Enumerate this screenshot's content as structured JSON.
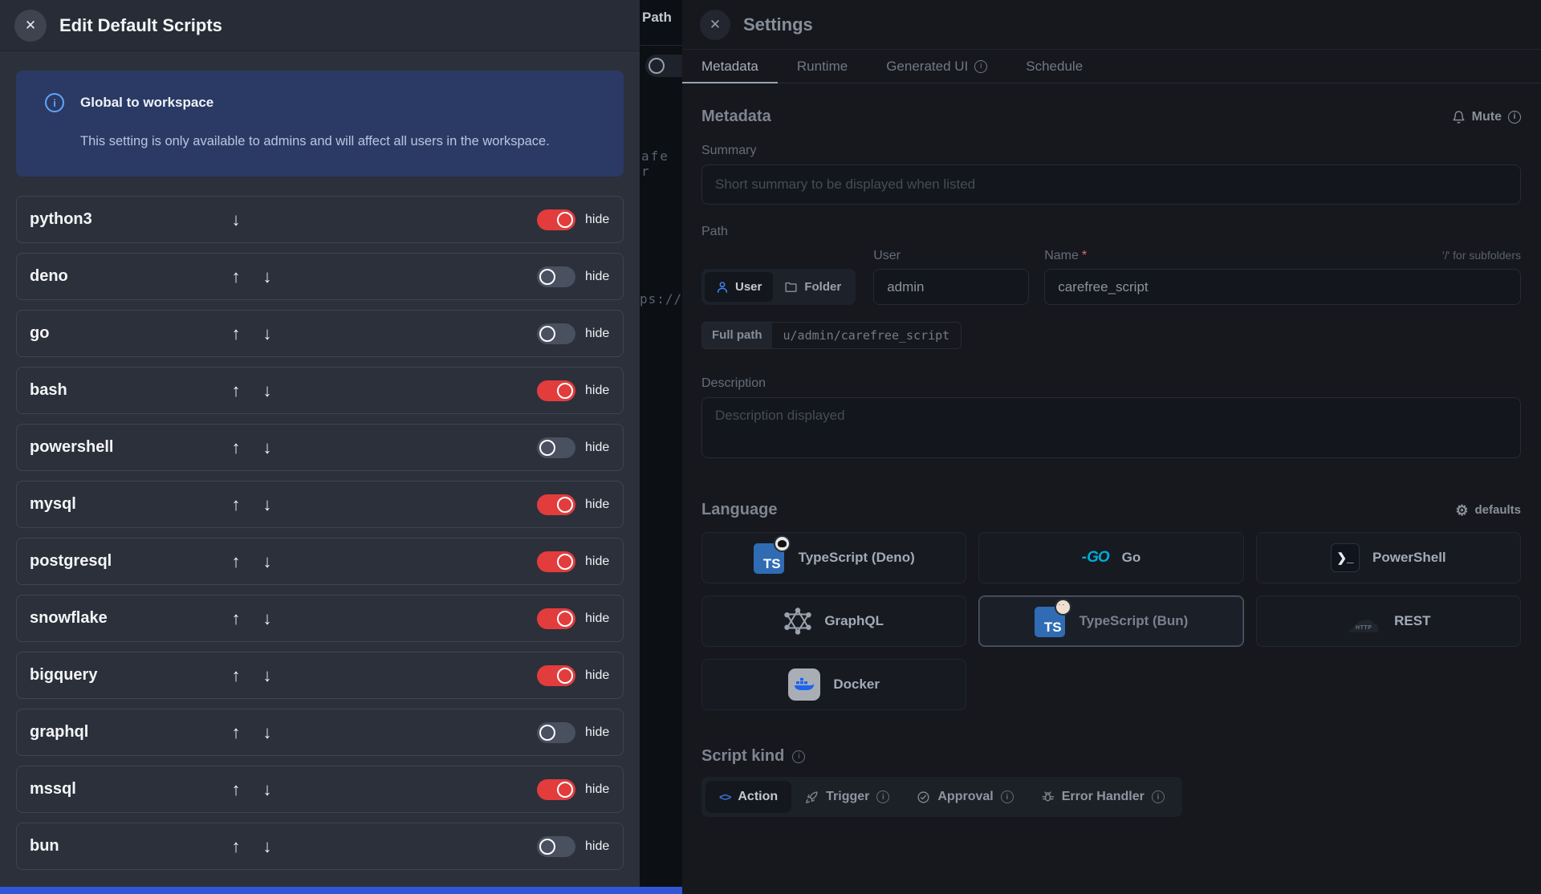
{
  "left_panel": {
    "title": "Edit Default Scripts",
    "info": {
      "title": "Global to workspace",
      "body": "This setting is only available to admins and will affect all users in the workspace."
    },
    "hide_label": "hide",
    "rows": [
      {
        "label": "python3",
        "up": false,
        "down": true,
        "hide_on": true
      },
      {
        "label": "deno",
        "up": true,
        "down": true,
        "hide_on": false
      },
      {
        "label": "go",
        "up": true,
        "down": true,
        "hide_on": false
      },
      {
        "label": "bash",
        "up": true,
        "down": true,
        "hide_on": true
      },
      {
        "label": "powershell",
        "up": true,
        "down": true,
        "hide_on": false
      },
      {
        "label": "mysql",
        "up": true,
        "down": true,
        "hide_on": true
      },
      {
        "label": "postgresql",
        "up": true,
        "down": true,
        "hide_on": true
      },
      {
        "label": "snowflake",
        "up": true,
        "down": true,
        "hide_on": true
      },
      {
        "label": "bigquery",
        "up": true,
        "down": true,
        "hide_on": true
      },
      {
        "label": "graphql",
        "up": true,
        "down": true,
        "hide_on": false
      },
      {
        "label": "mssql",
        "up": true,
        "down": true,
        "hide_on": true
      },
      {
        "label": "bun",
        "up": true,
        "down": true,
        "hide_on": false
      }
    ]
  },
  "background_strip": {
    "path_label": "Path",
    "code_fragment": "afe r",
    "url_fragment": "ps://"
  },
  "right_panel": {
    "title": "Settings",
    "tabs": [
      {
        "label": "Metadata",
        "active": true,
        "info": false
      },
      {
        "label": "Runtime",
        "active": false,
        "info": false
      },
      {
        "label": "Generated UI",
        "active": false,
        "info": true
      },
      {
        "label": "Schedule",
        "active": false,
        "info": false
      }
    ],
    "metadata_heading": "Metadata",
    "mute_label": "Mute",
    "summary_label": "Summary",
    "summary_placeholder": "Short summary to be displayed when listed",
    "path_heading": "Path",
    "owner_options": [
      {
        "label": "User",
        "icon": "person",
        "selected": true
      },
      {
        "label": "Folder",
        "icon": "folder",
        "selected": false
      }
    ],
    "user_label": "User",
    "user_value": "admin",
    "name_label": "Name",
    "name_required": "*",
    "name_value": "carefree_script",
    "subfolder_hint": "'/' for subfolders",
    "full_path_label": "Full path",
    "full_path_value": "u/admin/carefree_script",
    "description_label": "Description",
    "description_placeholder": "Description displayed",
    "language_heading": "Language",
    "defaults_label": "defaults",
    "languages": [
      {
        "label": "TypeScript (Deno)",
        "icon": "ts-deno",
        "selected": false
      },
      {
        "label": "Go",
        "icon": "go",
        "selected": false
      },
      {
        "label": "PowerShell",
        "icon": "powershell",
        "selected": false
      },
      {
        "label": "GraphQL",
        "icon": "graphql",
        "selected": false
      },
      {
        "label": "TypeScript (Bun)",
        "icon": "ts-bun",
        "selected": true
      },
      {
        "label": "REST",
        "icon": "rest",
        "selected": false
      },
      {
        "label": "Docker",
        "icon": "docker",
        "selected": false
      }
    ],
    "script_kind_heading": "Script kind",
    "kinds": [
      {
        "label": "Action",
        "icon": "code",
        "selected": true,
        "info": false
      },
      {
        "label": "Trigger",
        "icon": "rocket",
        "selected": false,
        "info": true
      },
      {
        "label": "Approval",
        "icon": "check",
        "selected": false,
        "info": true
      },
      {
        "label": "Error Handler",
        "icon": "bug",
        "selected": false,
        "info": true
      }
    ]
  },
  "colors": {
    "accent_blue": "#3b82f6",
    "toggle_on_red": "#e23c3c",
    "info_box_bg": "#2a3a64",
    "bottom_bar_blue": "#3156d6"
  }
}
